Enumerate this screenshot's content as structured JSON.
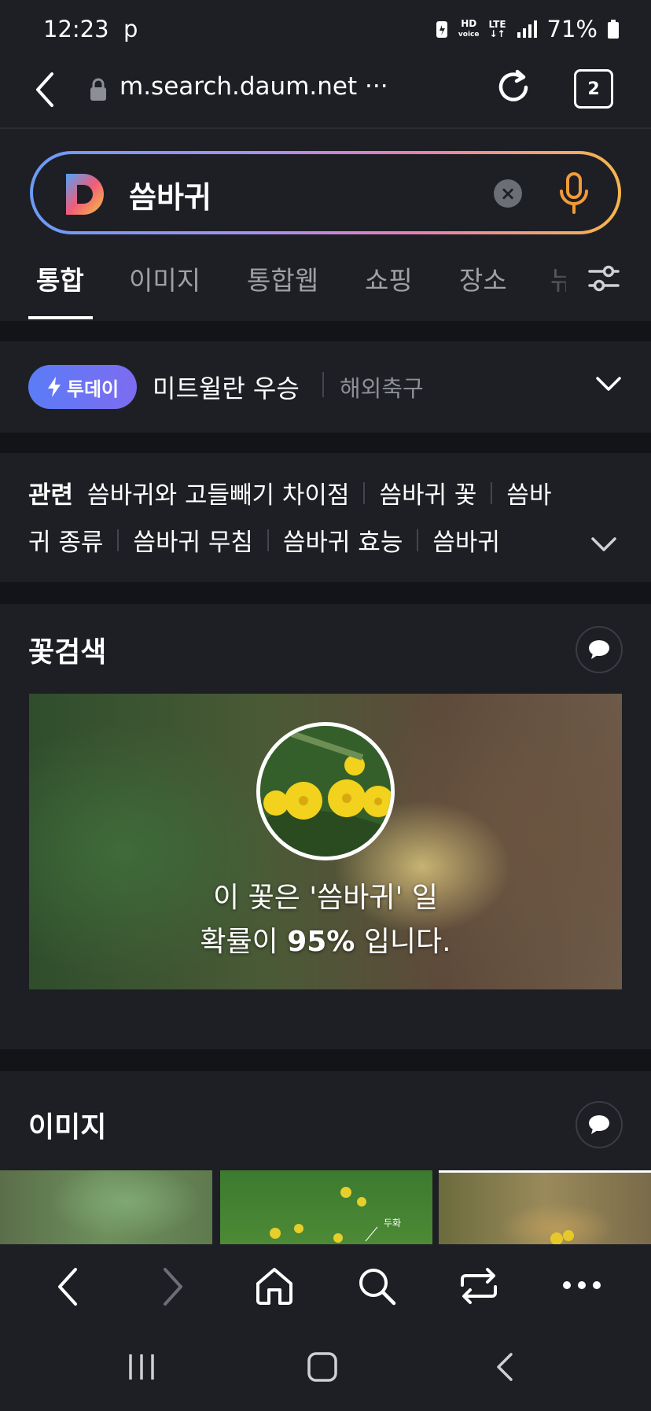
{
  "status_bar": {
    "time": "12:23",
    "notification": "p",
    "hd_voice": "HD",
    "lte": "LTE",
    "battery": "71%"
  },
  "url_bar": {
    "url": "m.search.daum.net ···",
    "tab_count": "2"
  },
  "search": {
    "query": "씀바귀"
  },
  "tabs": [
    "통합",
    "이미지",
    "통합웹",
    "쇼핑",
    "장소",
    "뉴"
  ],
  "today": {
    "badge": "투데이",
    "headline": "미트윌란 우승",
    "category": "해외축구"
  },
  "related": {
    "label": "관련",
    "row1": [
      "씀바귀와 고들빼기 차이점",
      "씀바귀 꽃",
      "씀바"
    ],
    "row2": [
      "귀 종류",
      "씀바귀 무침",
      "씀바귀 효능",
      "씀바귀"
    ]
  },
  "flower_search": {
    "title": "꽃검색",
    "line1": "이 꽃은 '씀바귀' 일",
    "line2_prefix": "확률이",
    "probability": "95%",
    "line2_suffix": "입니다."
  },
  "images_section": {
    "title": "이미지",
    "thumb_caption": "두화"
  },
  "colors": {
    "background": "#1e1f24",
    "divider": "#131418",
    "badge_blue": "#5b7cf7",
    "mic_orange": "#f29a3a"
  },
  "icons": [
    "back-icon",
    "lock-icon",
    "reload-icon",
    "daum-logo",
    "clear-icon",
    "mic-icon",
    "filter-icon",
    "lightning-icon",
    "chevron-down-icon",
    "chat-icon",
    "home-icon",
    "search-icon",
    "tabs-switch-icon",
    "more-icon"
  ]
}
